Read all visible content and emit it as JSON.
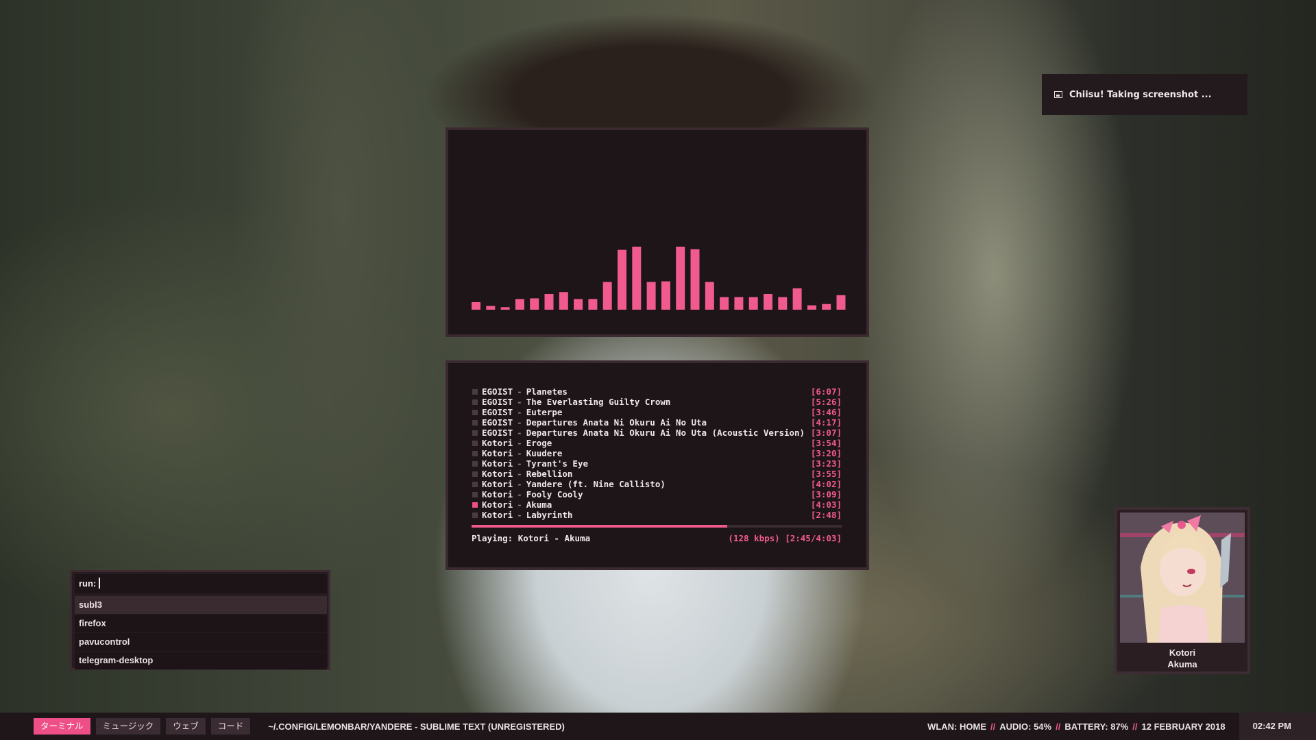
{
  "notification": {
    "icon": "image-icon",
    "text": "Chiisu! Taking screenshot ..."
  },
  "visualizer": {
    "accent": "#f05a8f",
    "levels": [
      0.12,
      0.06,
      0.04,
      0.17,
      0.18,
      0.25,
      0.28,
      0.17,
      0.17,
      0.44,
      0.95,
      1.0,
      0.44,
      0.45,
      1.0,
      0.96,
      0.44,
      0.2,
      0.2,
      0.2,
      0.25,
      0.2,
      0.34,
      0.07,
      0.09,
      0.23
    ]
  },
  "playlist": {
    "tracks": [
      {
        "artist": "EGOIST",
        "title": "Planetes",
        "duration": "[6:07]"
      },
      {
        "artist": "EGOIST",
        "title": "The Everlasting Guilty Crown",
        "duration": "[5:26]"
      },
      {
        "artist": "EGOIST",
        "title": "Euterpe",
        "duration": "[3:46]"
      },
      {
        "artist": "EGOIST",
        "title": "Departures Anata Ni Okuru Ai No Uta",
        "duration": "[4:17]"
      },
      {
        "artist": "EGOIST",
        "title": "Departures Anata Ni Okuru Ai No Uta (Acoustic Version)",
        "duration": "[3:07]"
      },
      {
        "artist": "Kotori",
        "title": "Eroge",
        "duration": "[3:54]"
      },
      {
        "artist": "Kotori",
        "title": "Kuudere",
        "duration": "[3:20]"
      },
      {
        "artist": "Kotori",
        "title": "Tyrant's Eye",
        "duration": "[3:23]"
      },
      {
        "artist": "Kotori",
        "title": "Rebellion",
        "duration": "[3:55]"
      },
      {
        "artist": "Kotori",
        "title": "Yandere (ft. Nine Callisto)",
        "duration": "[4:02]"
      },
      {
        "artist": "Kotori",
        "title": "Fooly Cooly",
        "duration": "[3:09]"
      },
      {
        "artist": "Kotori",
        "title": "Akuma",
        "duration": "[4:03]"
      },
      {
        "artist": "Kotori",
        "title": "Labyrinth",
        "duration": "[2:48]"
      }
    ],
    "separator": "-",
    "active_index": 11,
    "progress": 0.69,
    "now_playing": "Playing: Kotori - Akuma",
    "stream_info": "(128 kbps) [2:45/4:03]"
  },
  "runner": {
    "prompt": "run:",
    "options": [
      "subl3",
      "firefox",
      "pavucontrol",
      "telegram-desktop"
    ],
    "selected_index": 0
  },
  "album": {
    "artist": "Kotori",
    "title": "Akuma"
  },
  "bar": {
    "workspaces": [
      "ターミナル",
      "ミュージック",
      "ウェブ",
      "コード"
    ],
    "active_workspace": 0,
    "window_title": "~/.CONFIG/LEMONBAR/YANDERE - SUBLIME TEXT (UNREGISTERED)",
    "wlan": "WLAN: HOME",
    "audio": "AUDIO: 54%",
    "battery": "BATTERY: 87%",
    "date": "12 FEBRUARY 2018",
    "separator": "//",
    "time": "02:42 PM"
  }
}
